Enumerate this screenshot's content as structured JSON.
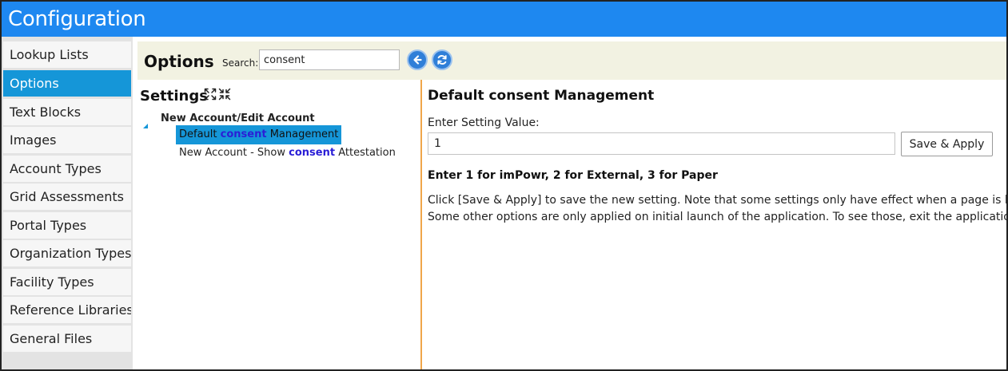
{
  "app": {
    "title": "Configuration"
  },
  "sidebar": {
    "items": [
      {
        "label": "Lookup Lists"
      },
      {
        "label": "Options",
        "active": true
      },
      {
        "label": "Text Blocks"
      },
      {
        "label": "Images"
      },
      {
        "label": "Account Types"
      },
      {
        "label": "Grid Assessments"
      },
      {
        "label": "Portal Types"
      },
      {
        "label": "Organization Types"
      },
      {
        "label": "Facility Types"
      },
      {
        "label": "Reference Libraries"
      },
      {
        "label": "General Files"
      }
    ]
  },
  "options_bar": {
    "title": "Options",
    "search_label": "Search:",
    "search_value": "consent",
    "back_icon": "arrow-left-circle-icon",
    "refresh_icon": "refresh-circle-icon"
  },
  "settings": {
    "title": "Settings",
    "expand_icon": "expand-all-icon",
    "collapse_icon": "collapse-all-icon",
    "tree": {
      "group_label": "New Account/Edit Account",
      "leaves": [
        {
          "before": "Default ",
          "highlight": "consent",
          "after": " Management",
          "selected": true
        },
        {
          "before": "New Account - Show ",
          "highlight": "consent",
          "after": " Attestation",
          "selected": false
        }
      ]
    }
  },
  "detail": {
    "title": "Default consent Management",
    "value_label": "Enter Setting Value:",
    "value": "1",
    "save_label": "Save & Apply",
    "instruction": "Enter 1 for imPowr, 2 for External, 3 for Paper",
    "note_1": "Click [Save & Apply] to save the new setting. Note that some settings only have effect when a page is load",
    "note_2": "Some other options are only applied on initial launch of the application. To see those, exit the application,"
  },
  "colors": {
    "titlebar": "#1e88f0",
    "nav_active": "#1596d8",
    "options_bar": "#f2f2e2",
    "search_highlight": "#2a1ed6",
    "divider": "#f0a64a"
  }
}
